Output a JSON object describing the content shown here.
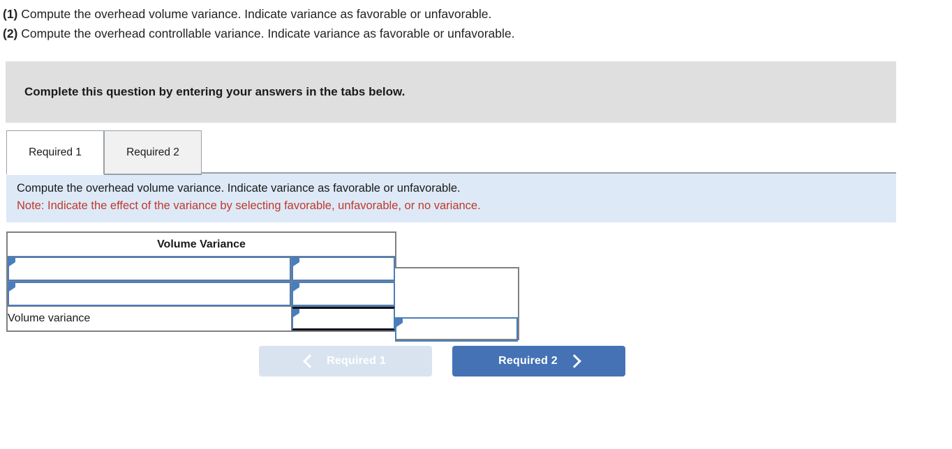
{
  "prompt": {
    "line1_num": "(1)",
    "line1_text": " Compute the overhead volume variance. Indicate variance as favorable or unfavorable.",
    "line2_num": "(2)",
    "line2_text": " Compute the overhead controllable variance. Indicate variance as favorable or unfavorable."
  },
  "banner": {
    "text": "Complete this question by entering your answers in the tabs below."
  },
  "tabs": [
    {
      "label": "Required 1",
      "active": true
    },
    {
      "label": "Required 2",
      "active": false
    }
  ],
  "info_panel": {
    "instruction": "Compute the overhead volume variance. Indicate variance as favorable or unfavorable.",
    "note": "Note: Indicate the effect of the variance by selecting favorable, unfavorable, or no variance."
  },
  "table": {
    "header": "Volume Variance",
    "rows": [
      {
        "label": "",
        "label_is_input": true,
        "value": "",
        "value_is_input": true,
        "effect": "",
        "effect_is_input": false
      },
      {
        "label": "",
        "label_is_input": true,
        "value": "",
        "value_is_input": true,
        "effect": "",
        "effect_is_input": false
      },
      {
        "label": "Volume variance",
        "label_is_input": false,
        "value": "",
        "value_is_input": true,
        "effect": "",
        "effect_is_input": true
      }
    ]
  },
  "nav": {
    "prev_label": "Required 1",
    "next_label": "Required 2",
    "prev_disabled": true
  },
  "colors": {
    "banner_gray": "#dfdfdf",
    "info_blue": "#dde9f7",
    "note_red": "#c0392b",
    "table_header_blue": "#85ace3",
    "cell_border_blue": "#4a7ebb",
    "button_active_blue": "#4472b5",
    "button_disabled_blue": "#d9e3f0",
    "focus_border": "#0b1120"
  },
  "icons": {
    "chevron_left": "chevron-left-icon",
    "chevron_right": "chevron-right-icon",
    "cell_marker": "dropdown-marker-icon"
  }
}
